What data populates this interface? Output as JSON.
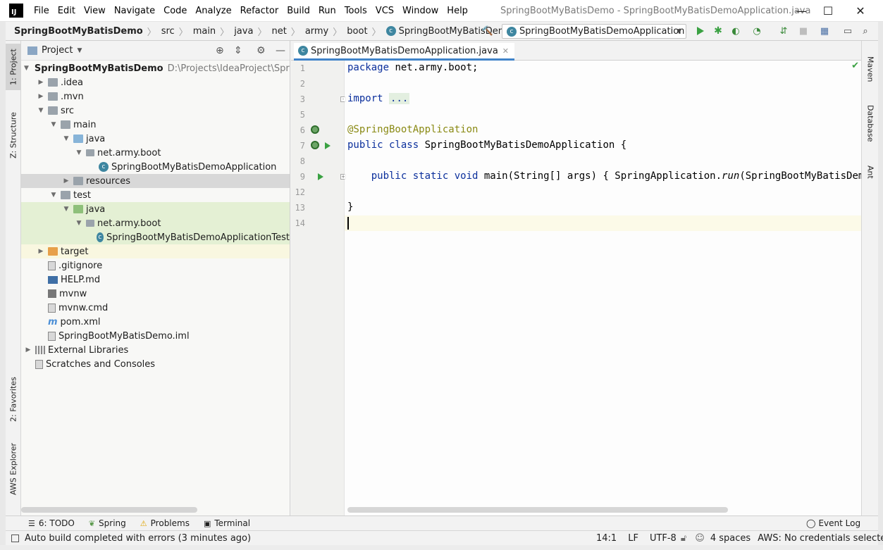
{
  "window": {
    "logo": "IJ",
    "menu": [
      "File",
      "Edit",
      "View",
      "Navigate",
      "Code",
      "Analyze",
      "Refactor",
      "Build",
      "Run",
      "Tools",
      "VCS",
      "Window",
      "Help"
    ],
    "title": "SpringBootMyBatisDemo - SpringBootMyBatisDemoApplication.java",
    "controls": {
      "minimize": "—",
      "maximize": "☐",
      "close": "✕"
    }
  },
  "breadcrumbs": [
    "SpringBootMyBatisDemo",
    "src",
    "main",
    "java",
    "net",
    "army",
    "boot",
    "SpringBootMyBatisDemoApplication"
  ],
  "toolbar": {
    "run_config": "SpringBootMyBatisDemoApplication"
  },
  "left_stripe": {
    "project": "1: Project",
    "structure": "Z: Structure",
    "favorites": "2: Favorites",
    "aws": "AWS Explorer"
  },
  "right_stripe": {
    "maven": "Maven",
    "database": "Database",
    "ant": "Ant"
  },
  "project_panel": {
    "title": "Project",
    "tree": [
      {
        "label": "SpringBootMyBatisDemo",
        "extra": "D:\\Projects\\IdeaProject\\SpringF",
        "depth": 0,
        "arrow": "▼",
        "icon": "folder",
        "bold": true
      },
      {
        "label": ".idea",
        "depth": 1,
        "arrow": "▶",
        "icon": "folder"
      },
      {
        "label": ".mvn",
        "depth": 1,
        "arrow": "▶",
        "icon": "folder"
      },
      {
        "label": "src",
        "depth": 1,
        "arrow": "▼",
        "icon": "folder"
      },
      {
        "label": "main",
        "depth": 2,
        "arrow": "▼",
        "icon": "folder"
      },
      {
        "label": "java",
        "depth": 3,
        "arrow": "▼",
        "icon": "folder-blue"
      },
      {
        "label": "net.army.boot",
        "depth": 4,
        "arrow": "▼",
        "icon": "package"
      },
      {
        "label": "SpringBootMyBatisDemoApplication",
        "depth": 5,
        "arrow": "",
        "icon": "class"
      },
      {
        "label": "resources",
        "depth": 3,
        "arrow": "▶",
        "icon": "folder",
        "state": "sel"
      },
      {
        "label": "test",
        "depth": 2,
        "arrow": "▼",
        "icon": "folder"
      },
      {
        "label": "java",
        "depth": 3,
        "arrow": "▼",
        "icon": "folder-green",
        "state": "green"
      },
      {
        "label": "net.army.boot",
        "depth": 4,
        "arrow": "▼",
        "icon": "package",
        "state": "green"
      },
      {
        "label": "SpringBootMyBatisDemoApplicationTest",
        "depth": 5,
        "arrow": "",
        "icon": "class",
        "state": "green"
      },
      {
        "label": "target",
        "depth": 1,
        "arrow": "▶",
        "icon": "folder-orange",
        "state": "yellow"
      },
      {
        "label": ".gitignore",
        "depth": 1,
        "arrow": "",
        "icon": "file"
      },
      {
        "label": "HELP.md",
        "depth": 1,
        "arrow": "",
        "icon": "md"
      },
      {
        "label": "mvnw",
        "depth": 1,
        "arrow": "",
        "icon": "mvnw"
      },
      {
        "label": "mvnw.cmd",
        "depth": 1,
        "arrow": "",
        "icon": "file"
      },
      {
        "label": "pom.xml",
        "depth": 1,
        "arrow": "",
        "icon": "maven"
      },
      {
        "label": "SpringBootMyBatisDemo.iml",
        "depth": 1,
        "arrow": "",
        "icon": "file"
      },
      {
        "label": "External Libraries",
        "depth": 0,
        "arrow": "▶",
        "icon": "libs"
      },
      {
        "label": "Scratches and Consoles",
        "depth": 0,
        "arrow": "",
        "icon": "scratch"
      }
    ]
  },
  "editor": {
    "tab": "SpringBootMyBatisDemoApplication.java",
    "lines": [
      {
        "num": "1",
        "parts": [
          [
            "kw",
            "package"
          ],
          [
            "",
            " net.army.boot;"
          ]
        ]
      },
      {
        "num": "2",
        "parts": []
      },
      {
        "num": "3",
        "parts": [
          [
            "kw",
            "import"
          ],
          [
            "",
            " "
          ],
          [
            "folded",
            "..."
          ]
        ]
      },
      {
        "num": "5",
        "parts": []
      },
      {
        "num": "6",
        "parts": [
          [
            "ann",
            "@SpringBootApplication"
          ]
        ]
      },
      {
        "num": "7",
        "parts": [
          [
            "kw",
            "public class"
          ],
          [
            "",
            " SpringBootMyBatisDemoApplication {"
          ]
        ]
      },
      {
        "num": "8",
        "parts": []
      },
      {
        "num": "9",
        "parts": [
          [
            "",
            "    "
          ],
          [
            "kw",
            "public static void"
          ],
          [
            "",
            " main(String[] args) { SpringApplication."
          ],
          [
            "italic",
            "run"
          ],
          [
            "",
            "(SpringBootMyBatisDemoAppl"
          ]
        ]
      },
      {
        "num": "12",
        "parts": []
      },
      {
        "num": "13",
        "parts": [
          [
            "",
            "}"
          ]
        ]
      },
      {
        "num": "14",
        "parts": []
      }
    ]
  },
  "bottom_tools": [
    {
      "icon": "☰",
      "label": "6: TODO"
    },
    {
      "icon": "❦",
      "label": "Spring"
    },
    {
      "icon": "⚠",
      "label": "Problems"
    },
    {
      "icon": "▣",
      "label": "Terminal"
    }
  ],
  "event_log": "Event Log",
  "status": {
    "message": "Auto build completed with errors (3 minutes ago)",
    "position": "14:1",
    "line_sep": "LF",
    "encoding": "UTF-8",
    "indent": "4 spaces",
    "aws": "AWS: No credentials selected"
  },
  "colors": {
    "accent": "#4083c9",
    "run_green": "#3aa142"
  }
}
